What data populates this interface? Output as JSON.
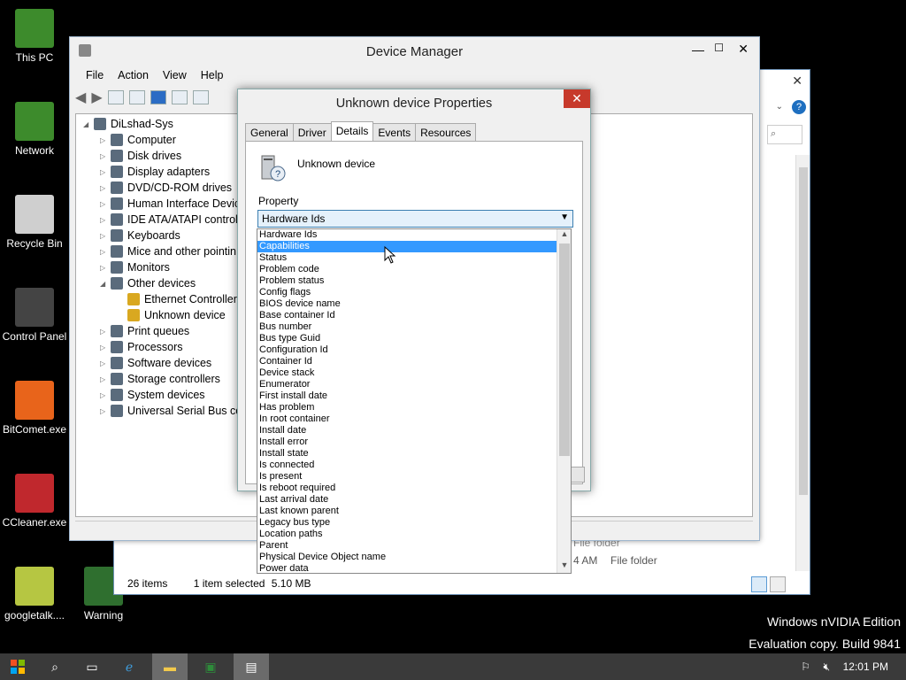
{
  "desktop": {
    "icons": [
      {
        "label": "This PC",
        "icon": "monitor-icon",
        "color": "#3d8b2c"
      },
      {
        "label": "Network",
        "icon": "network-icon",
        "color": "#3d8b2c"
      },
      {
        "label": "Recycle Bin",
        "icon": "recycle-bin-icon",
        "color": "#cfcfcf"
      },
      {
        "label": "Control Panel",
        "icon": "control-panel-icon",
        "color": "#444444"
      },
      {
        "label": "BitComet.exe",
        "icon": "bitcomet-icon",
        "color": "#e8641b"
      },
      {
        "label": "CCleaner.exe",
        "icon": "ccleaner-icon",
        "color": "#c0282d"
      },
      {
        "label": "googletalk....",
        "icon": "googletalk-icon",
        "color": "#b6c642"
      },
      {
        "label": "Warning",
        "icon": "warning-icon",
        "color": "#2f6f2f"
      }
    ],
    "watermark_line1": "Windows nVIDIA Edition",
    "watermark_line2": "Evaluation copy. Build 9841"
  },
  "device_manager": {
    "title": "Device Manager",
    "menu": [
      "File",
      "Action",
      "View",
      "Help"
    ],
    "tree": [
      {
        "label": "DiLshad-Sys",
        "level": 0,
        "arrow": "◢"
      },
      {
        "label": "Computer",
        "level": 1,
        "arrow": "▷"
      },
      {
        "label": "Disk drives",
        "level": 1,
        "arrow": "▷"
      },
      {
        "label": "Display adapters",
        "level": 1,
        "arrow": "▷"
      },
      {
        "label": "DVD/CD-ROM drives",
        "level": 1,
        "arrow": "▷"
      },
      {
        "label": "Human Interface Devic",
        "level": 1,
        "arrow": "▷"
      },
      {
        "label": "IDE ATA/ATAPI control",
        "level": 1,
        "arrow": "▷"
      },
      {
        "label": "Keyboards",
        "level": 1,
        "arrow": "▷"
      },
      {
        "label": "Mice and other pointin",
        "level": 1,
        "arrow": "▷"
      },
      {
        "label": "Monitors",
        "level": 1,
        "arrow": "▷"
      },
      {
        "label": "Other devices",
        "level": 1,
        "arrow": "◢"
      },
      {
        "label": "Ethernet Controller",
        "level": 2,
        "arrow": ""
      },
      {
        "label": "Unknown device",
        "level": 2,
        "arrow": ""
      },
      {
        "label": "Print queues",
        "level": 1,
        "arrow": "▷"
      },
      {
        "label": "Processors",
        "level": 1,
        "arrow": "▷"
      },
      {
        "label": "Software devices",
        "level": 1,
        "arrow": "▷"
      },
      {
        "label": "Storage controllers",
        "level": 1,
        "arrow": "▷"
      },
      {
        "label": "System devices",
        "level": 1,
        "arrow": "▷"
      },
      {
        "label": "Universal Serial Bus cor",
        "level": 1,
        "arrow": "▷"
      }
    ]
  },
  "dialog": {
    "title": "Unknown device Properties",
    "close": "✕",
    "tabs": [
      "General",
      "Driver",
      "Details",
      "Events",
      "Resources"
    ],
    "active_tab": "Details",
    "device_name": "Unknown device",
    "property_label": "Property",
    "selected_property": "Hardware Ids",
    "options": [
      "Hardware Ids",
      "Capabilities",
      "Status",
      "Problem code",
      "Problem status",
      "Config flags",
      "BIOS device name",
      "Base container Id",
      "Bus number",
      "Bus type Guid",
      "Configuration Id",
      "Container Id",
      "Device stack",
      "Enumerator",
      "First install date",
      "Has problem",
      "In root container",
      "Install date",
      "Install error",
      "Install state",
      "Is connected",
      "Is present",
      "Is reboot required",
      "Last arrival date",
      "Last known parent",
      "Legacy bus type",
      "Location paths",
      "Parent",
      "Physical Device Object name",
      "Power data"
    ],
    "highlighted_option": "Capabilities"
  },
  "explorer": {
    "items_count": "26 items",
    "selected": "1 item selected",
    "size": "5.10 MB",
    "row_time": "4 AM",
    "row_type": "File folder",
    "row_type_partial": "File folder"
  },
  "taskbar": {
    "clock": "12:01 PM"
  }
}
